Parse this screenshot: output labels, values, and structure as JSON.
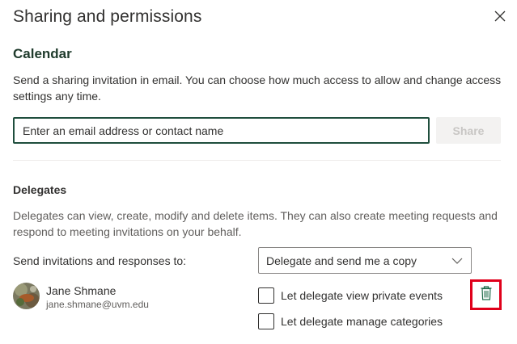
{
  "dialog": {
    "title": "Sharing and permissions"
  },
  "calendar": {
    "section_title": "Calendar",
    "description": "Send a sharing invitation in email. You can choose how much access to allow and change access settings any time.",
    "email_placeholder": "Enter an email address or contact name",
    "share_label": "Share"
  },
  "delegates": {
    "title": "Delegates",
    "description": "Delegates can view, create, modify and delete items. They can also create meeting requests and respond to meeting invitations on your behalf.",
    "send_label": "Send invitations and responses to:",
    "send_option": "Delegate and send me a copy",
    "person": {
      "name": "Jane Shmane",
      "email": "jane.shmane@uvm.edu"
    },
    "options": {
      "private_events": "Let delegate view private events",
      "manage_categories": "Let delegate manage categories"
    }
  },
  "icons": {
    "close": "close-icon",
    "chevron": "chevron-down-icon",
    "delete": "trash-icon"
  },
  "colors": {
    "accent": "#1f4e3d",
    "highlight": "#e0001b",
    "delete_icon": "#1f6b4a"
  }
}
